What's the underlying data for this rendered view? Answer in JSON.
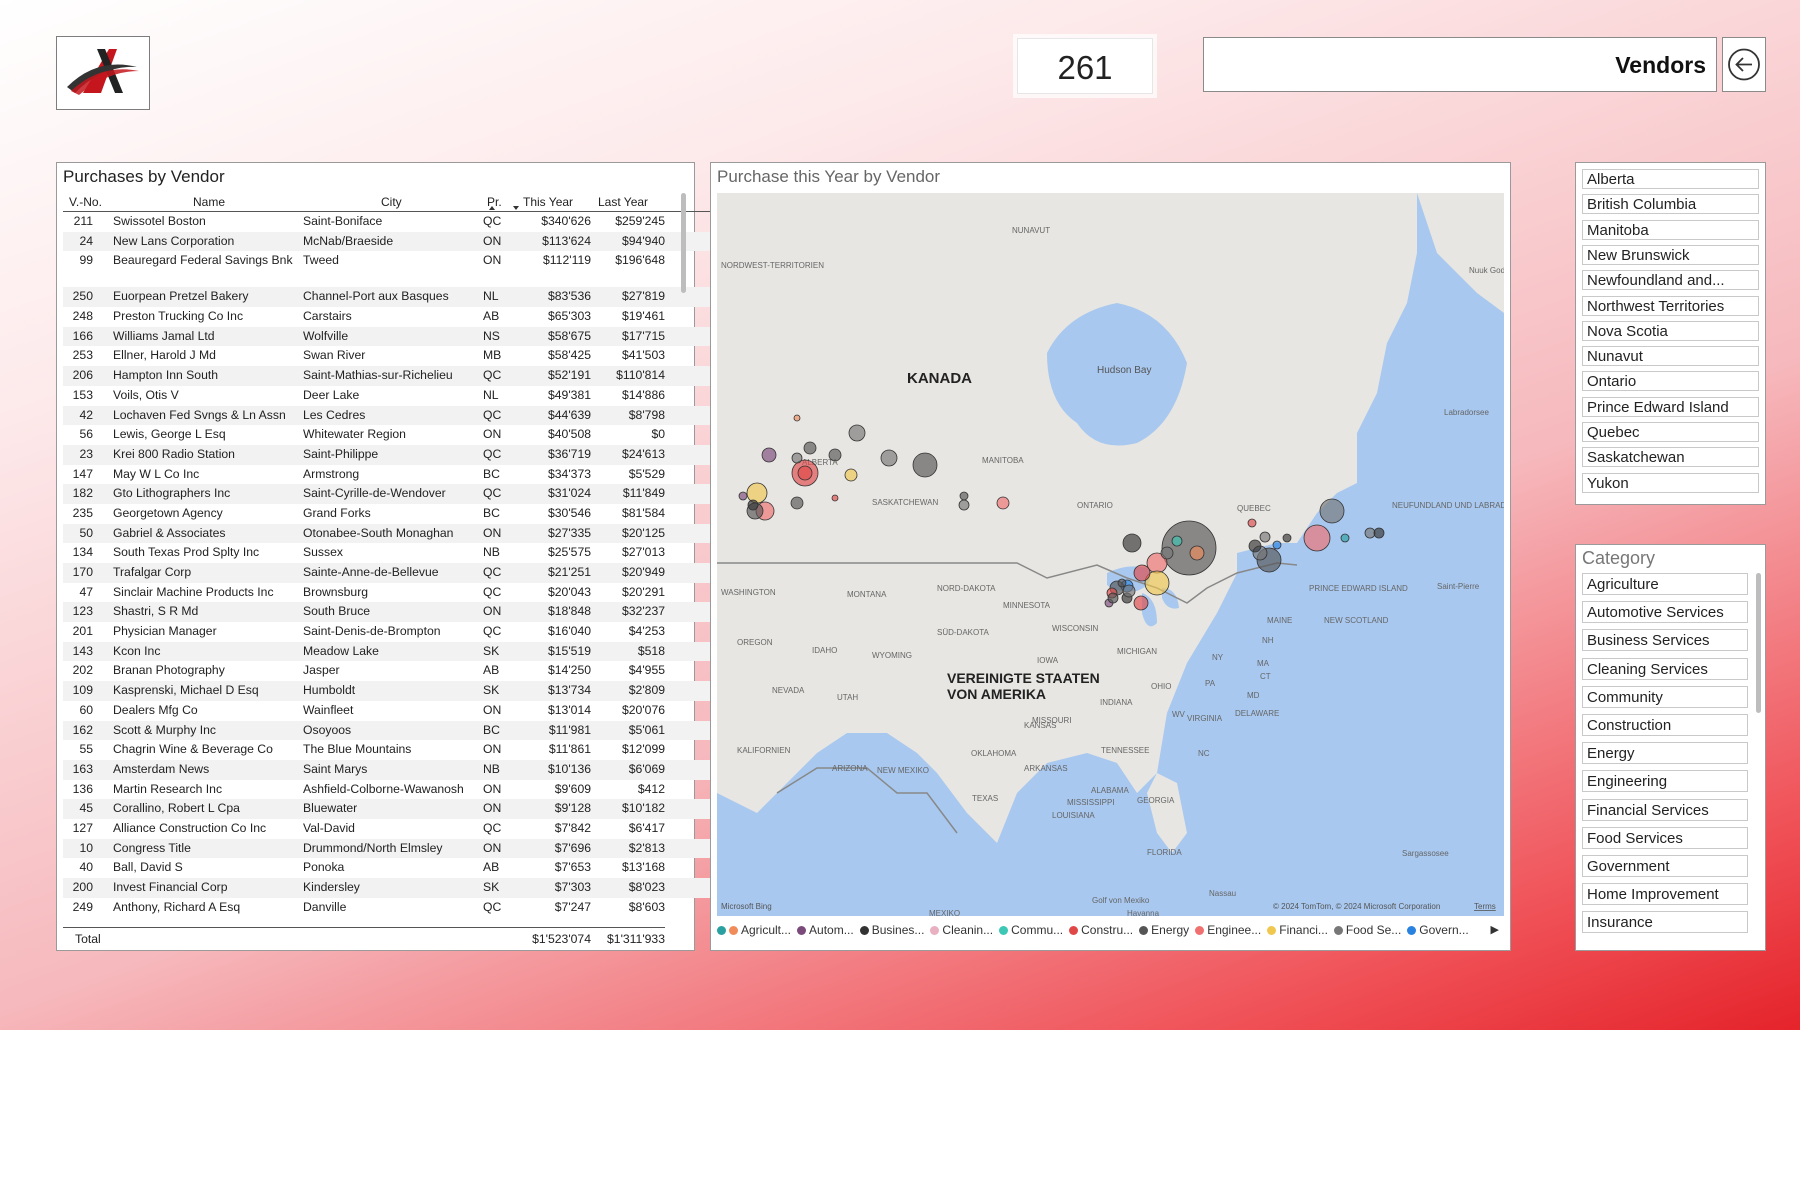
{
  "header": {
    "kpi_value": "261",
    "page_title": "Vendors"
  },
  "table": {
    "title": "Purchases by Vendor",
    "columns": [
      "V.-No.",
      "Name",
      "City",
      "Pr.",
      "This Year",
      "Last Year"
    ],
    "rows": [
      [
        "211",
        "Swissotel Boston",
        "Saint-Boniface",
        "QC",
        "$340'626",
        "$259'245"
      ],
      [
        "24",
        "New Lans Corporation",
        "McNab/Braeside",
        "ON",
        "$113'624",
        "$94'940"
      ],
      [
        "99",
        "Beauregard Federal Savings Bnk",
        "Tweed",
        "ON",
        "$112'119",
        "$196'648"
      ],
      [
        "250",
        "Euorpean Pretzel Bakery",
        "Channel-Port aux Basques",
        "NL",
        "$83'536",
        "$27'819"
      ],
      [
        "248",
        "Preston Trucking Co Inc",
        "Carstairs",
        "AB",
        "$65'303",
        "$19'461"
      ],
      [
        "166",
        "Williams Jamal Ltd",
        "Wolfville",
        "NS",
        "$58'675",
        "$17'715"
      ],
      [
        "253",
        "Ellner, Harold J Md",
        "Swan River",
        "MB",
        "$58'425",
        "$41'503"
      ],
      [
        "206",
        "Hampton Inn South",
        "Saint-Mathias-sur-Richelieu",
        "QC",
        "$52'191",
        "$110'814"
      ],
      [
        "153",
        "Voils, Otis V",
        "Deer Lake",
        "NL",
        "$49'381",
        "$14'886"
      ],
      [
        "42",
        "Lochaven Fed Svngs & Ln Assn",
        "Les Cedres",
        "QC",
        "$44'639",
        "$8'798"
      ],
      [
        "56",
        "Lewis, George L Esq",
        "Whitewater Region",
        "ON",
        "$40'508",
        "$0"
      ],
      [
        "23",
        "Krei 800 Radio Station",
        "Saint-Philippe",
        "QC",
        "$36'719",
        "$24'613"
      ],
      [
        "147",
        "May W L Co Inc",
        "Armstrong",
        "BC",
        "$34'373",
        "$5'529"
      ],
      [
        "182",
        "Gto Lithographers Inc",
        "Saint-Cyrille-de-Wendover",
        "QC",
        "$31'024",
        "$11'849"
      ],
      [
        "235",
        "Georgetown Agency",
        "Grand Forks",
        "BC",
        "$30'546",
        "$81'584"
      ],
      [
        "50",
        "Gabriel & Associates",
        "Otonabee-South Monaghan",
        "ON",
        "$27'335",
        "$20'125"
      ],
      [
        "134",
        "South Texas Prod Splty Inc",
        "Sussex",
        "NB",
        "$25'575",
        "$27'013"
      ],
      [
        "170",
        "Trafalgar Corp",
        "Sainte-Anne-de-Bellevue",
        "QC",
        "$21'251",
        "$20'949"
      ],
      [
        "47",
        "Sinclair Machine Products Inc",
        "Brownsburg",
        "QC",
        "$20'043",
        "$20'291"
      ],
      [
        "123",
        "Shastri, S R Md",
        "South Bruce",
        "ON",
        "$18'848",
        "$32'237"
      ],
      [
        "201",
        "Physician Manager",
        "Saint-Denis-de-Brompton",
        "QC",
        "$16'040",
        "$4'253"
      ],
      [
        "143",
        "Kcon Inc",
        "Meadow Lake",
        "SK",
        "$15'519",
        "$518"
      ],
      [
        "202",
        "Branan Photography",
        "Jasper",
        "AB",
        "$14'250",
        "$4'955"
      ],
      [
        "109",
        "Kasprenski, Michael D Esq",
        "Humboldt",
        "SK",
        "$13'734",
        "$2'809"
      ],
      [
        "60",
        "Dealers Mfg Co",
        "Wainfleet",
        "ON",
        "$13'014",
        "$20'076"
      ],
      [
        "162",
        "Scott & Murphy Inc",
        "Osoyoos",
        "BC",
        "$11'981",
        "$5'061"
      ],
      [
        "55",
        "Chagrin Wine & Beverage Co",
        "The Blue Mountains",
        "ON",
        "$11'861",
        "$12'099"
      ],
      [
        "163",
        "Amsterdam News",
        "Saint Marys",
        "NB",
        "$10'136",
        "$6'069"
      ],
      [
        "136",
        "Martin Research Inc",
        "Ashfield-Colborne-Wawanosh",
        "ON",
        "$9'609",
        "$412"
      ],
      [
        "45",
        "Corallino, Robert L Cpa",
        "Bluewater",
        "ON",
        "$9'128",
        "$10'182"
      ],
      [
        "127",
        "Alliance Construction Co Inc",
        "Val-David",
        "QC",
        "$7'842",
        "$6'417"
      ],
      [
        "10",
        "Congress Title",
        "Drummond/North Elmsley",
        "ON",
        "$7'696",
        "$2'813"
      ],
      [
        "40",
        "Ball, David S",
        "Ponoka",
        "AB",
        "$7'653",
        "$13'168"
      ],
      [
        "200",
        "Invest Financial Corp",
        "Kindersley",
        "SK",
        "$7'303",
        "$8'023"
      ],
      [
        "249",
        "Anthony, Richard A Esq",
        "Danville",
        "QC",
        "$7'247",
        "$8'603"
      ]
    ],
    "total_label": "Total",
    "total_this_year": "$1'523'074",
    "total_last_year": "$1'311'933"
  },
  "map": {
    "title": "Purchase this Year by Vendor",
    "labels": [
      "KANADA",
      "VEREINIGTE STAATEN",
      "VON AMERIKA",
      "Hudson Bay",
      "NUNAVUT",
      "NORDWEST-TERRITORIEN",
      "ALBERTA",
      "SASKATCHEWAN",
      "MANITOBA",
      "ONTARIO",
      "QUEBEC",
      "NEUFUNDLAND UND LABRADOR",
      "Labradorsee",
      "Nuuk Godthåb",
      "WASHINGTON",
      "MONTANA",
      "NORD-DAKOTA",
      "MINNESOTA",
      "OREGON",
      "IDAHO",
      "SÜD-DAKOTA",
      "WISCONSIN",
      "MICHIGAN",
      "WYOMING",
      "IOWA",
      "NEVADA",
      "UTAH",
      "KALIFORNIEN",
      "ARIZONA",
      "NEW MEXIKO",
      "TEXAS",
      "OKLAHOMA",
      "KANSAS",
      "MISSOURI",
      "ARKANSAS",
      "TENNESSEE",
      "ALABAMA",
      "GEORGIA",
      "MISSISSIPPI",
      "LOUISIANA",
      "FLORIDA",
      "INDIANA",
      "OHIO",
      "PA",
      "NY",
      "VIRGINIA",
      "WV",
      "NC",
      "MAINE",
      "NH",
      "MA",
      "CT",
      "DELAWARE",
      "MD",
      "Golf von Mexiko",
      "Sargassosee",
      "Nassau",
      "PRINCE EDWARD ISLAND",
      "NEW SCOTLAND",
      "Saint-Pierre",
      "MEXIKO",
      "Havanna"
    ],
    "attribution": "© 2024 TomTom, © 2024 Microsoft Corporation",
    "attribution_terms": "Terms",
    "bing_logo": "Microsoft Bing",
    "legend": [
      {
        "label": "Agricult...",
        "color": "#f08c5a"
      },
      {
        "label": "Autom...",
        "color": "#7a4a7a"
      },
      {
        "label": "Busines...",
        "color": "#333333"
      },
      {
        "label": "Cleanin...",
        "color": "#e8b0c0"
      },
      {
        "label": "Commu...",
        "color": "#3cc8b4"
      },
      {
        "label": "Constru...",
        "color": "#e04848"
      },
      {
        "label": "Energy",
        "color": "#555555"
      },
      {
        "label": "Enginee...",
        "color": "#f07070"
      },
      {
        "label": "Financi...",
        "color": "#f0c850"
      },
      {
        "label": "Food Se...",
        "color": "#777777"
      },
      {
        "label": "Govern...",
        "color": "#2a82e0"
      }
    ],
    "legend_lead_color": "#2aa0a0"
  },
  "provinces": [
    "Alberta",
    "British Columbia",
    "Manitoba",
    "New Brunswick",
    "Newfoundland and...",
    "Northwest Territories",
    "Nova Scotia",
    "Nunavut",
    "Ontario",
    "Prince Edward Island",
    "Quebec",
    "Saskatchewan",
    "Yukon"
  ],
  "category": {
    "title": "Category",
    "items": [
      "Agriculture",
      "Automotive Services",
      "Business Services",
      "Cleaning Services",
      "Community",
      "Construction",
      "Energy",
      "Engineering",
      "Financial Services",
      "Food Services",
      "Government",
      "Home Improvement",
      "Insurance"
    ]
  }
}
